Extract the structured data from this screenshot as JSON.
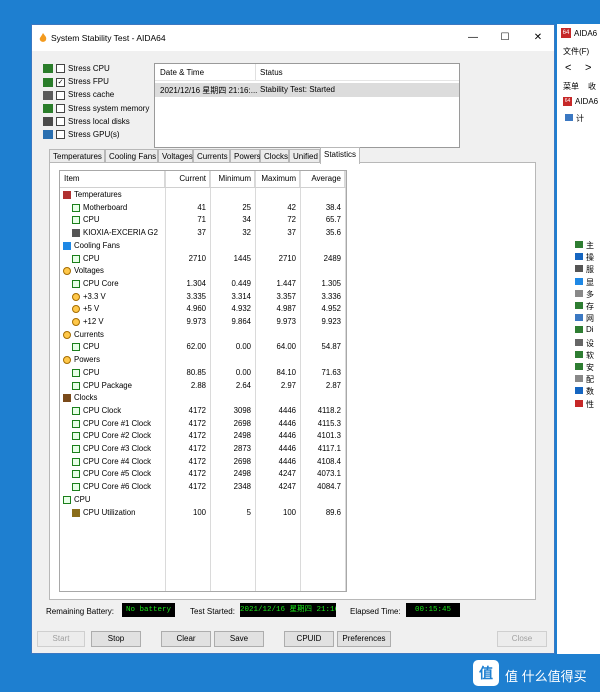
{
  "window": {
    "title": "System Stability Test - AIDA64"
  },
  "stress_options": [
    {
      "label": "Stress CPU",
      "checked": false,
      "icon": "cpu-icon"
    },
    {
      "label": "Stress FPU",
      "checked": true,
      "icon": "fpu-icon"
    },
    {
      "label": "Stress cache",
      "checked": false,
      "icon": "cache-icon"
    },
    {
      "label": "Stress system memory",
      "checked": false,
      "icon": "memory-icon"
    },
    {
      "label": "Stress local disks",
      "checked": false,
      "icon": "disk-icon"
    },
    {
      "label": "Stress GPU(s)",
      "checked": false,
      "icon": "gpu-icon"
    }
  ],
  "log": {
    "col_datetime": "Date & Time",
    "col_status": "Status",
    "row_datetime": "2021/12/16 星期四 21:16:...",
    "row_status": "Stability Test: Started"
  },
  "tabs": [
    "Temperatures",
    "Cooling Fans",
    "Voltages",
    "Currents",
    "Powers",
    "Clocks",
    "Unified",
    "Statistics"
  ],
  "active_tab": "Statistics",
  "table": {
    "headers": [
      "Item",
      "Current",
      "Minimum",
      "Maximum",
      "Average"
    ],
    "rows": [
      {
        "type": "group",
        "name": "Temperatures",
        "icon": "thermometer-icon"
      },
      {
        "type": "item",
        "name": "Motherboard",
        "icon": "motherboard-icon",
        "cur": "41",
        "min": "25",
        "max": "42",
        "avg": "38.4"
      },
      {
        "type": "item",
        "name": "CPU",
        "icon": "cpu-icon",
        "cur": "71",
        "min": "34",
        "max": "72",
        "avg": "65.7"
      },
      {
        "type": "item",
        "name": "KIOXIA-EXCERIA G2 ...",
        "icon": "disk-icon",
        "cur": "37",
        "min": "32",
        "max": "37",
        "avg": "35.6"
      },
      {
        "type": "group",
        "name": "Cooling Fans",
        "icon": "fan-icon"
      },
      {
        "type": "item",
        "name": "CPU",
        "icon": "cpu-icon",
        "cur": "2710",
        "min": "1445",
        "max": "2710",
        "avg": "2489"
      },
      {
        "type": "group",
        "name": "Voltages",
        "icon": "voltage-icon"
      },
      {
        "type": "item",
        "name": "CPU Core",
        "icon": "cpu-icon",
        "cur": "1.304",
        "min": "0.449",
        "max": "1.447",
        "avg": "1.305"
      },
      {
        "type": "item",
        "name": "+3.3 V",
        "icon": "voltage-icon",
        "cur": "3.335",
        "min": "3.314",
        "max": "3.357",
        "avg": "3.336"
      },
      {
        "type": "item",
        "name": "+5 V",
        "icon": "voltage-icon",
        "cur": "4.960",
        "min": "4.932",
        "max": "4.987",
        "avg": "4.952"
      },
      {
        "type": "item",
        "name": "+12 V",
        "icon": "voltage-icon",
        "cur": "9.973",
        "min": "9.864",
        "max": "9.973",
        "avg": "9.923"
      },
      {
        "type": "group",
        "name": "Currents",
        "icon": "voltage-icon"
      },
      {
        "type": "item",
        "name": "CPU",
        "icon": "cpu-icon",
        "cur": "62.00",
        "min": "0.00",
        "max": "64.00",
        "avg": "54.87"
      },
      {
        "type": "group",
        "name": "Powers",
        "icon": "voltage-icon"
      },
      {
        "type": "item",
        "name": "CPU",
        "icon": "cpu-icon",
        "cur": "80.85",
        "min": "0.00",
        "max": "84.10",
        "avg": "71.63"
      },
      {
        "type": "item",
        "name": "CPU Package",
        "icon": "cpu-icon",
        "cur": "2.88",
        "min": "2.64",
        "max": "2.97",
        "avg": "2.87"
      },
      {
        "type": "group",
        "name": "Clocks",
        "icon": "clock-icon"
      },
      {
        "type": "item",
        "name": "CPU Clock",
        "icon": "cpu-icon",
        "cur": "4172",
        "min": "3098",
        "max": "4446",
        "avg": "4118.2"
      },
      {
        "type": "item",
        "name": "CPU Core #1 Clock",
        "icon": "cpu-icon",
        "cur": "4172",
        "min": "2698",
        "max": "4446",
        "avg": "4115.3"
      },
      {
        "type": "item",
        "name": "CPU Core #2 Clock",
        "icon": "cpu-icon",
        "cur": "4172",
        "min": "2498",
        "max": "4446",
        "avg": "4101.3"
      },
      {
        "type": "item",
        "name": "CPU Core #3 Clock",
        "icon": "cpu-icon",
        "cur": "4172",
        "min": "2873",
        "max": "4446",
        "avg": "4117.1"
      },
      {
        "type": "item",
        "name": "CPU Core #4 Clock",
        "icon": "cpu-icon",
        "cur": "4172",
        "min": "2698",
        "max": "4446",
        "avg": "4108.4"
      },
      {
        "type": "item",
        "name": "CPU Core #5 Clock",
        "icon": "cpu-icon",
        "cur": "4172",
        "min": "2498",
        "max": "4247",
        "avg": "4073.1"
      },
      {
        "type": "item",
        "name": "CPU Core #6 Clock",
        "icon": "cpu-icon",
        "cur": "4172",
        "min": "2348",
        "max": "4247",
        "avg": "4084.7"
      },
      {
        "type": "group",
        "name": "CPU",
        "icon": "cpu-icon"
      },
      {
        "type": "item",
        "name": "CPU Utilization",
        "icon": "hourglass-icon",
        "cur": "100",
        "min": "5",
        "max": "100",
        "avg": "89.6"
      }
    ]
  },
  "status": {
    "battery_label": "Remaining Battery:",
    "battery_value": "No battery",
    "started_label": "Test Started:",
    "started_value": "2021/12/16 星期四 21:16:51",
    "elapsed_label": "Elapsed Time:",
    "elapsed_value": "00:15:45"
  },
  "buttons": {
    "start": "Start",
    "stop": "Stop",
    "clear": "Clear",
    "save": "Save",
    "cpuid": "CPUID",
    "preferences": "Preferences",
    "close": "Close"
  },
  "side_window": {
    "title": "AIDA6",
    "menu_file": "文件(F)",
    "menu_main": "菜单",
    "tab_fav": "收",
    "app_item": "AIDA6",
    "tree_items": [
      "计",
      "主",
      "操",
      "服",
      "显",
      "多",
      "存",
      "网",
      "Di",
      "设",
      "软",
      "安",
      "配",
      "数",
      "性"
    ]
  },
  "watermark": {
    "text": "值 什么值得买",
    "logo": "值"
  },
  "colors": {
    "led_text": "#19e619",
    "led_bg": "#000000",
    "desktop": "#1e7fd0"
  }
}
